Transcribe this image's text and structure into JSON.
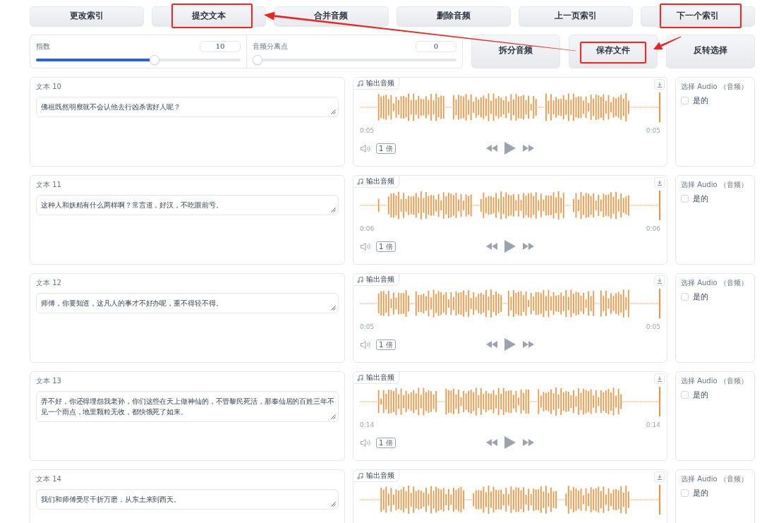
{
  "top_buttons": [
    {
      "label": "更改索引",
      "highlighted": false
    },
    {
      "label": "提交文本",
      "highlighted": true
    },
    {
      "label": "合并音频",
      "highlighted": false
    },
    {
      "label": "删除音频",
      "highlighted": false
    },
    {
      "label": "上一页索引",
      "highlighted": false
    },
    {
      "label": "下一个索引",
      "highlighted": true
    }
  ],
  "sliders": [
    {
      "label": "指数",
      "value": "10",
      "level": 0.585
    },
    {
      "label": "音频分离点",
      "value": "0",
      "level": 0
    }
  ],
  "action_buttons": [
    {
      "label": "拆分音频",
      "highlighted": false
    },
    {
      "label": "保存文件",
      "highlighted": true
    },
    {
      "label": "反转选择",
      "highlighted": false
    }
  ],
  "rows": [
    {
      "text_label": "文本 10",
      "text": "佛祖既然明察就不会认他去行凶杀害好人呢？",
      "audio_label": "输出音频",
      "start_time": "0:05",
      "end_time": "0:05",
      "speed": "1 倍",
      "select_label": "选择 Audio （音频）",
      "option_label": "是的",
      "checked": false
    },
    {
      "text_label": "文本 11",
      "text": "这种人和妖精有什么两样啊？常言道，好汉，不吃眼前亏。",
      "audio_label": "输出音频",
      "start_time": "0:06",
      "end_time": "0:06",
      "speed": "1 倍",
      "select_label": "选择 Audio （音频）",
      "option_label": "是的",
      "checked": false
    },
    {
      "text_label": "文本 12",
      "text": "师傅，你要知道，这凡人的事才不好办呢，重不得轻不得。",
      "audio_label": "输出音频",
      "start_time": "0:05",
      "end_time": "0:05",
      "speed": "1 倍",
      "select_label": "选择 Audio （音频）",
      "option_label": "是的",
      "checked": false
    },
    {
      "text_label": "文本 13",
      "text": "弄不好，你还得埋怨我老孙，你们这些在天上做神仙的，不管黎民死活，那奉仙居的百姓三年不见一个雨点，地里颗粒无收，都快饿死了如来。",
      "audio_label": "输出音频",
      "start_time": "0:14",
      "end_time": "0:14",
      "speed": "1 倍",
      "select_label": "选择 Audio （音频）",
      "option_label": "是的",
      "checked": false
    },
    {
      "text_label": "文本 14",
      "text": "我们和师傅受尽千折万磨，从东土来到西天。",
      "audio_label": "输出音频",
      "select_label": "选择 Audio （音频）",
      "option_label": "是的",
      "checked": false
    }
  ]
}
